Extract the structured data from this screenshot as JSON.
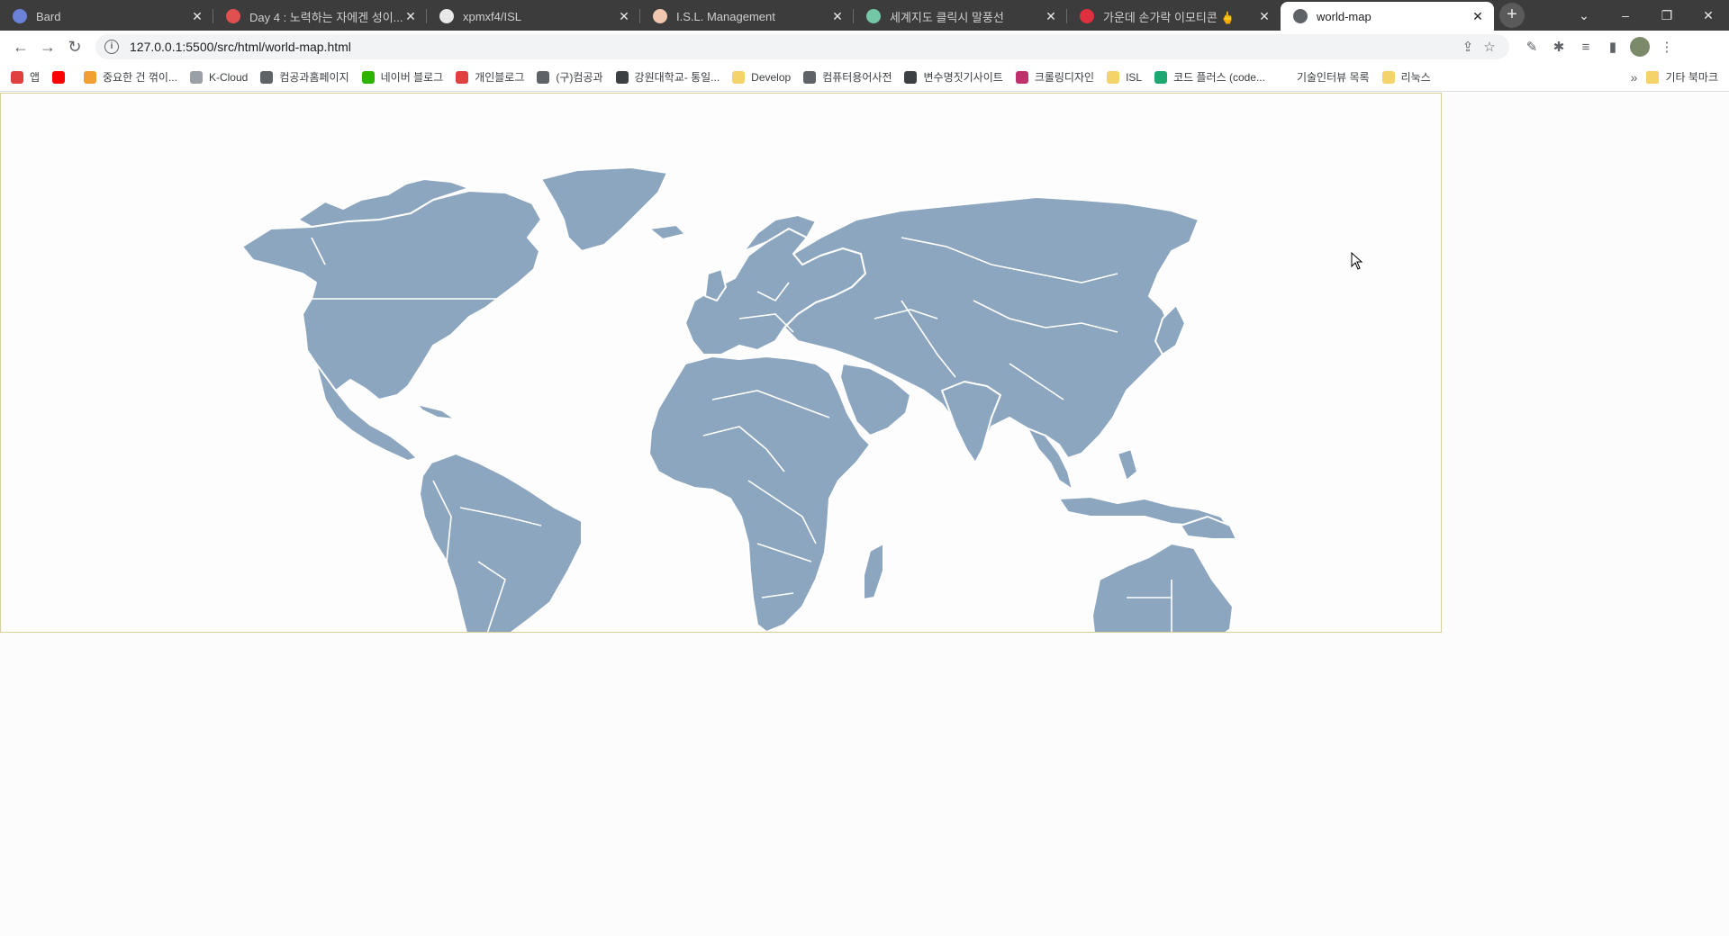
{
  "tabs": [
    {
      "label": "Bard",
      "favicon_color": "#6a82d8",
      "active": false
    },
    {
      "label": "Day 4 : 노력하는 자에겐 성이...",
      "favicon_color": "#e05050",
      "active": false
    },
    {
      "label": "xpmxf4/ISL",
      "favicon_color": "#e8e8e8",
      "active": false
    },
    {
      "label": "I.S.L. Management",
      "favicon_color": "#f0c8b0",
      "active": false
    },
    {
      "label": "세계지도 클릭시 말풍선",
      "favicon_color": "#74c7a6",
      "active": false
    },
    {
      "label": "가운데 손가락 이모티콘 🖕",
      "favicon_color": "#e03040",
      "active": false
    },
    {
      "label": "world-map",
      "favicon_color": "#5f6368",
      "active": true
    }
  ],
  "address_bar": {
    "url": "127.0.0.1:5500/src/html/world-map.html"
  },
  "bookmarks": [
    {
      "label": "앱",
      "color": "#e04040"
    },
    {
      "label": "",
      "color": "#ff0000"
    },
    {
      "label": "중요한 건 꺾이...",
      "color": "#f0a030"
    },
    {
      "label": "K-Cloud",
      "color": "#9aa0a6"
    },
    {
      "label": "컴공과홈페이지",
      "color": "#5f6368"
    },
    {
      "label": "네이버 블로그",
      "color": "#2db400"
    },
    {
      "label": "개인블로그",
      "color": "#e04040"
    },
    {
      "label": "(구)컴공과",
      "color": "#5f6368"
    },
    {
      "label": "강원대학교- 통일...",
      "color": "#3c4043"
    },
    {
      "label": "Develop",
      "color": "#f4d36b"
    },
    {
      "label": "컴퓨터용어사전",
      "color": "#5f6368"
    },
    {
      "label": "변수명짓기사이트",
      "color": "#3c4043"
    },
    {
      "label": "크롤링디자인",
      "color": "#c0306a"
    },
    {
      "label": "ISL",
      "color": "#f4d36b"
    },
    {
      "label": "코드 플러스 (code...",
      "color": "#1ea870"
    },
    {
      "label": "기술인터뷰 목록",
      "color": "#ffffff"
    },
    {
      "label": "리눅스",
      "color": "#f4d36b"
    }
  ],
  "bookmarks_more": "»",
  "bookmarks_other": "기타 북마크",
  "map": {
    "land_color": "#8da6bf",
    "border_color": "#ffffff",
    "background": "#fdfdfd",
    "frame_border": "#d8cf9a"
  },
  "icons": {
    "back": "arrow-left-icon",
    "forward": "arrow-right-icon",
    "reload": "reload-icon",
    "share": "share-icon",
    "star": "star-icon",
    "eyedropper": "eyedropper-icon",
    "extensions": "puzzle-icon",
    "media": "media-icon",
    "sidepanel": "sidepanel-icon",
    "menu": "kebab-menu-icon"
  }
}
